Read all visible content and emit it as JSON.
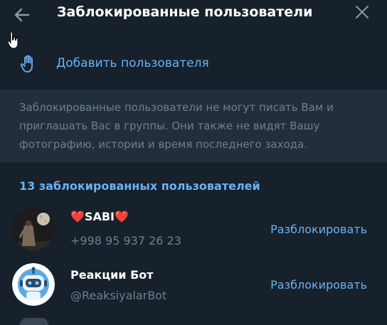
{
  "header": {
    "title": "Заблокированные пользователи"
  },
  "add_user": {
    "label": "Добавить пользователя"
  },
  "info": {
    "text": "Заблокированные пользователи не могут писать Вам и приглашать Вас в группы. Они также не видят Вашу фотографию, истории и время последнего захода."
  },
  "blocked": {
    "count_label": "13 заблокированных пользователей",
    "users": [
      {
        "name_heart_left": "❤️",
        "name": "SABI",
        "name_heart_right": "❤️",
        "subtitle": "+998 95 937 26 23",
        "action": "Разблокировать"
      },
      {
        "name": "Реакции Бот",
        "subtitle": "@ReaksiyalarBot",
        "action": "Разблокировать"
      }
    ]
  },
  "colors": {
    "background": "#17212b",
    "panel": "#232e3c",
    "accent": "#6ab2f2",
    "muted": "#6d7f8f"
  },
  "icons": {
    "back": "arrow-left-icon",
    "close": "close-icon",
    "add": "hand-icon",
    "cursor": "hand-pointer-icon"
  }
}
